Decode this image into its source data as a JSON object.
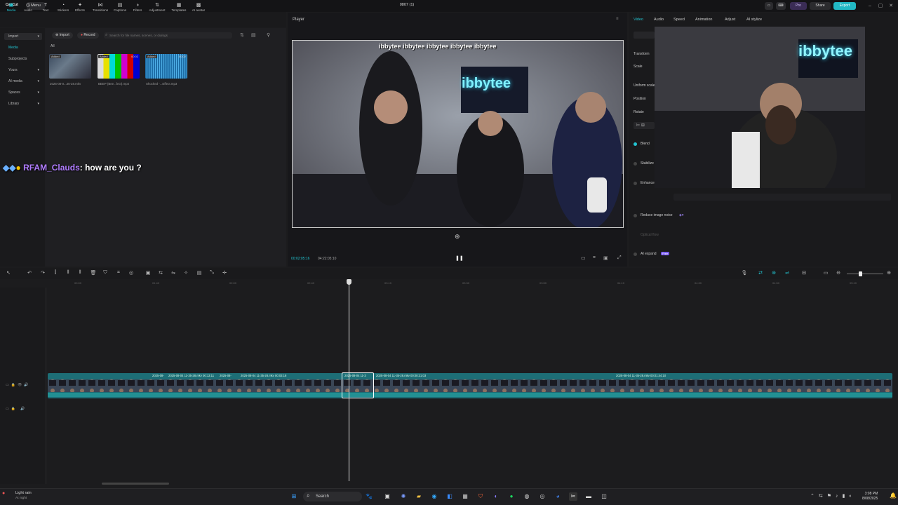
{
  "app": {
    "logo": "CapCut",
    "menu_label": "Menu",
    "doc_title": "0807 (1)",
    "pro_label": "Pro",
    "share_label": "Share",
    "export_label": "Export"
  },
  "tools": [
    {
      "label": "Media",
      "icon": "▣"
    },
    {
      "label": "Audio",
      "icon": "◷"
    },
    {
      "label": "Text",
      "icon": "T"
    },
    {
      "label": "Stickers",
      "icon": "◔"
    },
    {
      "label": "Effects",
      "icon": "✦"
    },
    {
      "label": "Transitions",
      "icon": "⋈"
    },
    {
      "label": "Captions",
      "icon": "▤"
    },
    {
      "label": "Filters",
      "icon": "◑"
    },
    {
      "label": "Adjustment",
      "icon": "⇅"
    },
    {
      "label": "Templates",
      "icon": "▦"
    },
    {
      "label": "AI avatar",
      "icon": "▩"
    }
  ],
  "leftnav": [
    "Import",
    "Media",
    "Subprojects",
    "Yours",
    "AI media",
    "Spaces",
    "Library"
  ],
  "media": {
    "import_label": "Import",
    "record_label": "Record",
    "search_placeholder": "Search for file names, scenes, or dialogs",
    "filter_all": "All",
    "items": [
      {
        "badge": "Added",
        "duration": "",
        "name": "2025-08-0...35-28.mkv"
      },
      {
        "badge": "Added",
        "duration": "00:02",
        "name": "BEEP (Bee...fect).mp4"
      },
      {
        "badge": "Added",
        "duration": "00:02",
        "name": "Shocked -...Effect.mp3"
      }
    ]
  },
  "chat": {
    "user": "RFAM_Clauds",
    "message": ": how are you ?"
  },
  "player": {
    "label": "Player",
    "banner": "ibbytee  ibbytee  ibbytee  ibbytee  ibbytee",
    "neon_text": "ibbytee",
    "current_time": "00:02:05:16",
    "total_time": "04:22:05:10"
  },
  "right": {
    "tabs": [
      "Video",
      "Audio",
      "Speed",
      "Animation",
      "Adjust",
      "AI stylize"
    ],
    "labels": [
      "Transform",
      "Scale",
      "Uniform scale",
      "Position",
      "Rotate",
      "Blend",
      "Stabilize",
      "Enhance"
    ],
    "reduce_noise": "Reduce image noise",
    "optical_flow": "Optical flow",
    "ai_expand": "AI expand",
    "ai_expand_badge": "Free"
  },
  "timeline": {
    "ticks": [
      "00:00",
      "01:40",
      "02:00",
      "02:40",
      "03:10",
      "03:30",
      "03:50",
      "04:10",
      "04:30",
      "04:50",
      "05:10"
    ],
    "clip_labels": [
      {
        "text": "2025-08-",
        "pos": 217
      },
      {
        "text": "2025-08-04 11-35-28.mkv  00:13:11",
        "pos": 240
      },
      {
        "text": "2025-08-",
        "pos": 313
      },
      {
        "text": "2025-08-04 11-35-28.mkv  00:03:18",
        "pos": 343
      },
      {
        "text": "2025-08-04 11-3",
        "pos": 491
      },
      {
        "text": "2025-08-04 11-35-28.mkv  00:00:31:03",
        "pos": 536
      },
      {
        "text": "2025-08-04 11-35-28.mkv  00:01:44:10",
        "pos": 878
      }
    ]
  },
  "taskbar": {
    "weather_main": "Light rain",
    "weather_sub": "At night",
    "search_label": "Search",
    "time": "3:08 PM",
    "date": "8/08/2025"
  }
}
